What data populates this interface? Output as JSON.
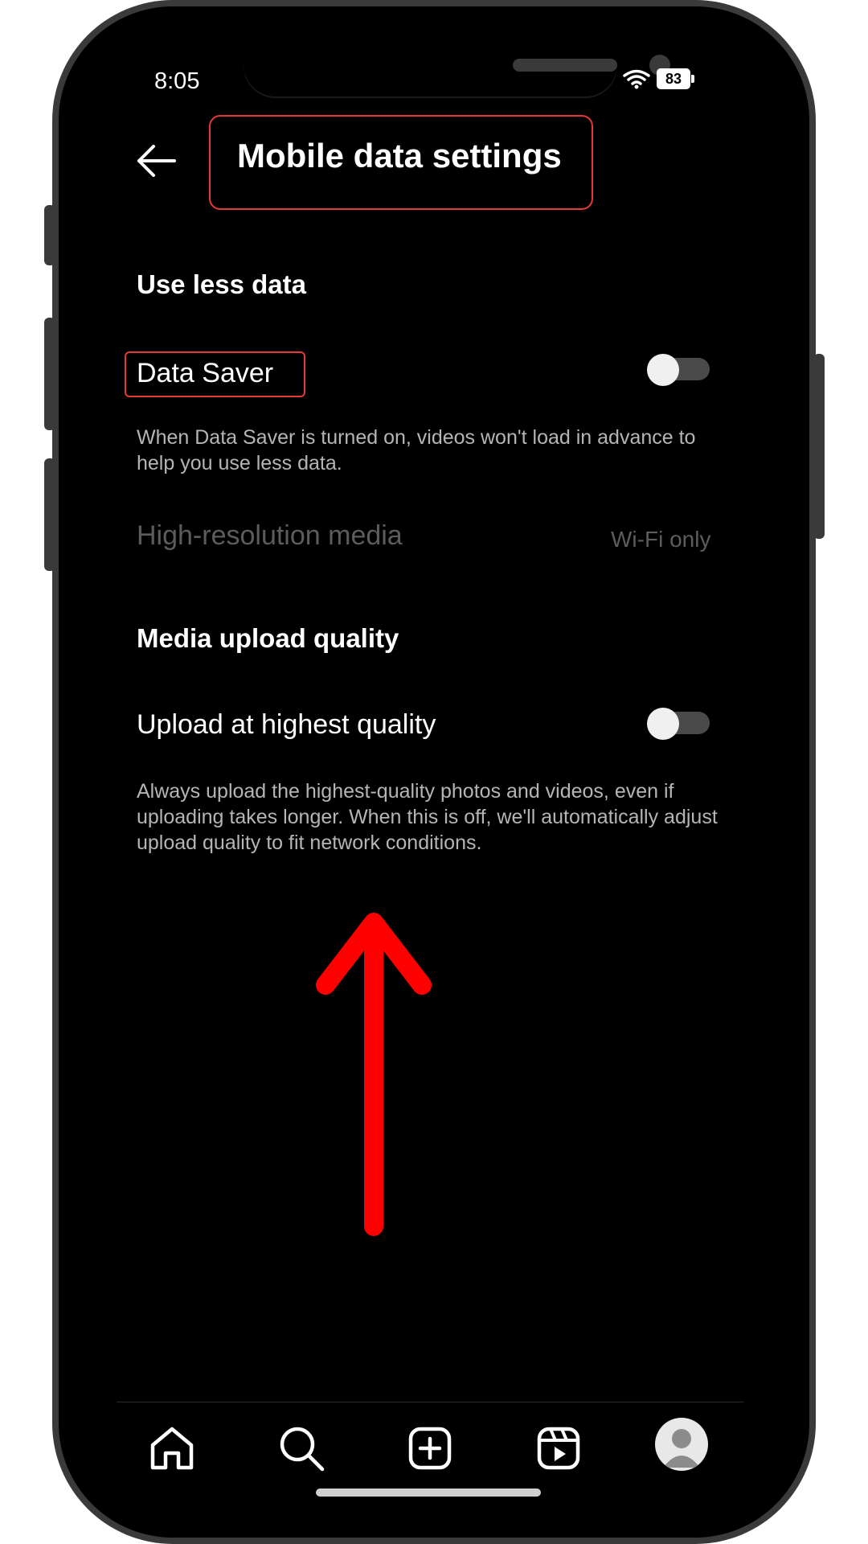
{
  "status_bar": {
    "time": "8:05",
    "battery": "83"
  },
  "header": {
    "title": "Mobile data settings"
  },
  "sections": {
    "use_less_data": {
      "header": "Use less data",
      "data_saver_label": "Data Saver",
      "data_saver_on": false,
      "data_saver_desc": "When Data Saver is turned on, videos won't load in advance to help you use less data.",
      "high_res_label": "High-resolution media",
      "high_res_value": "Wi-Fi only"
    },
    "media_upload": {
      "header": "Media upload quality",
      "upload_label": "Upload at highest quality",
      "upload_on": false,
      "upload_desc": "Always upload the highest-quality photos and videos, even if uploading takes longer. When this is off, we'll automatically adjust upload quality to fit network conditions."
    }
  },
  "bottom_nav": {
    "items": [
      "home-icon",
      "search-icon",
      "create-icon",
      "reels-icon",
      "profile-avatar"
    ]
  },
  "colors": {
    "highlight": "#e53935",
    "annotation_arrow": "#ff0000",
    "background": "#000000"
  }
}
